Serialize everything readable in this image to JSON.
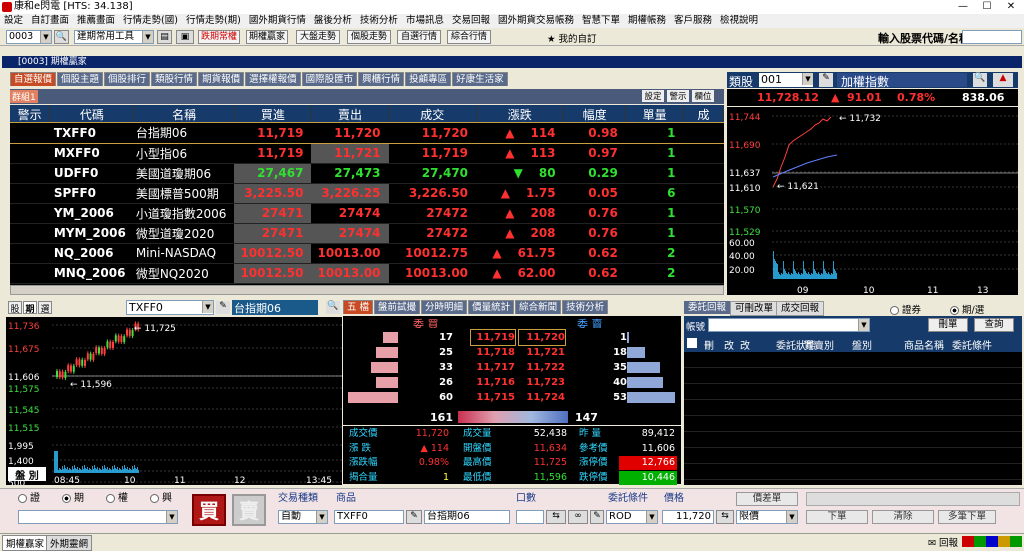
{
  "window": {
    "title": "康和e閃電 [HTS: 34.138]"
  },
  "menu": [
    "設定",
    "自訂畫面",
    "推薦畫面",
    "行情走勢(國)",
    "行情走勢(期)",
    "國外期貨行情",
    "盤後分析",
    "技術分析",
    "市場訊息",
    "交易回報",
    "國外期貨交易帳務",
    "智慧下單",
    "期權帳務",
    "客戶服務",
    "檢視說明"
  ],
  "toolbar": {
    "screen_no": "0003",
    "tool_select": "建期常用工具",
    "buttons": [
      "跌期常權",
      "期權贏家",
      "大盤走勢",
      "個股走勢",
      "自選行情",
      "綜合行情"
    ],
    "my_custom": "我的自訂",
    "stock_search_label": "輸入股票代碼/名稱:"
  },
  "panel_title": "[0003] 期權贏家",
  "quote_tabs": [
    "自選報價",
    "個股主題",
    "個股排行",
    "類股行情",
    "期貨報價",
    "選擇權報價",
    "國際股匯市",
    "興櫃行情",
    "投顧專區",
    "好康生活家"
  ],
  "group_label": "群組1",
  "grid_buttons": [
    "設定",
    "警示",
    "欄位"
  ],
  "columns": [
    "警示",
    "代碼",
    "名稱",
    "買進",
    "賣出",
    "成交",
    "漲跌",
    "幅度",
    "單量",
    "成"
  ],
  "rows": [
    {
      "code": "TXFF0",
      "name": "台指期06",
      "bid": "11,719",
      "ask": "11,720",
      "last": "11,720",
      "arrow": "▲",
      "chg": "114",
      "pct": "0.98",
      "vol": "1",
      "dir": "up"
    },
    {
      "code": "MXFF0",
      "name": "小型指06",
      "bid": "11,719",
      "ask": "11,721",
      "last": "11,719",
      "arrow": "▲",
      "chg": "113",
      "pct": "0.97",
      "vol": "1",
      "dir": "up"
    },
    {
      "code": "UDFF0",
      "name": "美國道瓊期06",
      "bid": "27,467",
      "ask": "27,473",
      "last": "27,470",
      "arrow": "▼",
      "chg": "80",
      "pct": "0.29",
      "vol": "1",
      "dir": "down"
    },
    {
      "code": "SPFF0",
      "name": "美國標普500期",
      "bid": "3,225.50",
      "ask": "3,226.25",
      "last": "3,226.50",
      "arrow": "▲",
      "chg": "1.75",
      "pct": "0.05",
      "vol": "6",
      "dir": "up"
    },
    {
      "code": "YM_2006",
      "name": "小道瓊指數2006",
      "bid": "27471",
      "ask": "27474",
      "last": "27472",
      "arrow": "▲",
      "chg": "208",
      "pct": "0.76",
      "vol": "1",
      "dir": "up"
    },
    {
      "code": "MYM_2006",
      "name": "微型道瓊2020",
      "bid": "27471",
      "ask": "27474",
      "last": "27472",
      "arrow": "▲",
      "chg": "208",
      "pct": "0.76",
      "vol": "1",
      "dir": "up"
    },
    {
      "code": "NQ_2006",
      "name": "Mini-NASDAQ",
      "bid": "10012.50",
      "ask": "10013.00",
      "last": "10012.75",
      "arrow": "▲",
      "chg": "61.75",
      "pct": "0.62",
      "vol": "2",
      "dir": "up"
    },
    {
      "code": "MNQ_2006",
      "name": "微型NQ2020",
      "bid": "10012.50",
      "ask": "10013.00",
      "last": "10013.00",
      "arrow": "▲",
      "chg": "62.00",
      "pct": "0.62",
      "vol": "2",
      "dir": "up"
    }
  ],
  "index_panel": {
    "label": "類股",
    "code": "001",
    "name": "加權指數",
    "price": "11,728.12",
    "arrow": "▲",
    "chg": "91.01",
    "pct": "0.78%",
    "volume": "838.06",
    "ticks": [
      "11,744",
      "11,690",
      "11,637",
      "11,610",
      "11,570",
      "11,529",
      "60.00",
      "40.00",
      "20.00"
    ],
    "xticks": [
      "09",
      "10",
      "11",
      "13"
    ],
    "hi": "11,732",
    "lo": "11,621"
  },
  "fut_panel": {
    "tabs": [
      "股",
      "期",
      "選"
    ],
    "code": "TXFF0",
    "name": "台指期06",
    "ticks": [
      "11,736",
      "11,675",
      "11,606",
      "11,575",
      "11,545",
      "11,515",
      "1,995",
      "1,400",
      "1,000",
      "500"
    ],
    "xticks": [
      "08:45",
      "10",
      "11",
      "12",
      "13:45"
    ],
    "hi": "11,725",
    "lo": "11,596",
    "corner": "盤 別"
  },
  "book_tabs": [
    "五 檔",
    "盤前試撮",
    "分時明細",
    "價量統計",
    "綜合新聞",
    "技術分析"
  ],
  "book": {
    "buy_label": "委 買",
    "sell_label": "委 賣",
    "bids": [
      {
        "qty": "17",
        "px": "11,719"
      },
      {
        "qty": "25",
        "px": "11,718"
      },
      {
        "qty": "33",
        "px": "11,717"
      },
      {
        "qty": "26",
        "px": "11,716"
      },
      {
        "qty": "60",
        "px": "11,715"
      }
    ],
    "asks": [
      {
        "px": "11,720",
        "qty": "1"
      },
      {
        "px": "11,721",
        "qty": "18"
      },
      {
        "px": "11,722",
        "qty": "35"
      },
      {
        "px": "11,723",
        "qty": "40"
      },
      {
        "px": "11,724",
        "qty": "53"
      }
    ],
    "bid_total": "161",
    "ask_total": "147",
    "bid_frac": [
      0.3,
      0.45,
      0.55,
      0.45,
      1.0
    ],
    "ask_frac": [
      0.03,
      0.35,
      0.65,
      0.72,
      0.95
    ]
  },
  "stats": [
    {
      "l": "成交價",
      "v": "11,720",
      "l2": "成交量",
      "v2": "52,438",
      "l3": "昨 量",
      "v3": "89,412"
    },
    {
      "l": "漲 跌",
      "v": "▲ 114",
      "l2": "開盤價",
      "v2": "11,634",
      "l3": "參考價",
      "v3": "11,606"
    },
    {
      "l": "漲跌幅",
      "v": "0.98%",
      "l2": "最高價",
      "v2": "11,725",
      "l3": "漲停價",
      "v3": "12,766"
    },
    {
      "l": "揭合量",
      "v": "1",
      "l2": "最低價",
      "v2": "11,596",
      "l3": "跌停價",
      "v3": "10,446"
    }
  ],
  "order_tabs": [
    "委託回報",
    "可刪改單",
    "成交回報"
  ],
  "order_radio": [
    "證券",
    "期/選"
  ],
  "order_filter": {
    "label": "帳號",
    "buttons": [
      "刪單",
      "查詢"
    ]
  },
  "order_cols": [
    "刪",
    "改",
    "改",
    "委託狀態",
    "買賣別",
    "盤別",
    "商品名稱",
    "委託條件"
  ],
  "order_form": {
    "radios": [
      "證",
      "期",
      "權",
      "興"
    ],
    "buy": "買",
    "sell": "賣",
    "type_label": "交易種類",
    "type": "自動",
    "product_label": "商品",
    "product": "TXFF0",
    "product_name": "台指期06",
    "qty_label": "口數",
    "cond_label": "委託條件",
    "cond": "ROD",
    "price_label": "價格",
    "price": "11,720",
    "price_type": "限價",
    "spread": "價差單",
    "buttons": [
      "下單",
      "清除",
      "多筆下單"
    ]
  },
  "statusbar": {
    "tabs": [
      "期權贏家",
      "外期靈網"
    ],
    "right": "回報"
  }
}
